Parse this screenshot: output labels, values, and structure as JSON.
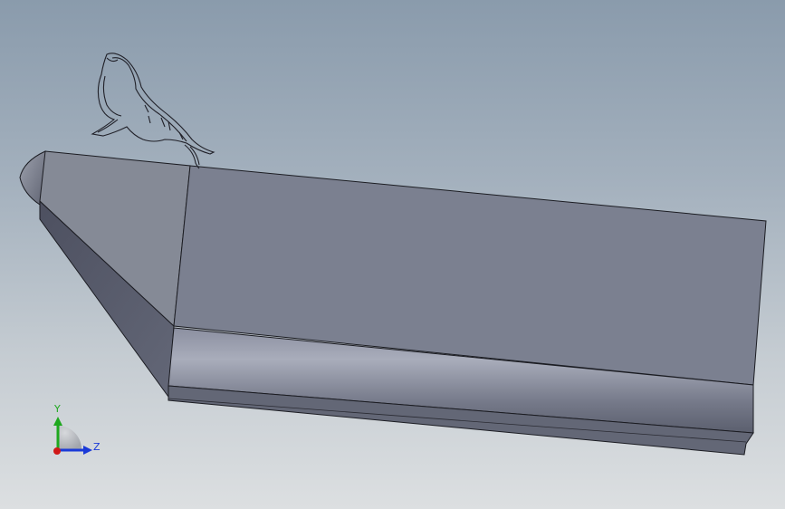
{
  "viewport": {
    "model": "boat-hull-model",
    "colors": {
      "face_top": "#7b8090",
      "face_bow": "#848995",
      "face_bow_side": "#55596a",
      "rail_light": "#a7abb9",
      "rail_dark": "#5d6170",
      "edge": "#1b1c22",
      "sketch": "#202028"
    }
  },
  "triad": {
    "y_label": "Y",
    "z_label": "Z",
    "y_color": "#1ea81e",
    "z_color": "#1a3ad8",
    "x_color": "#d01818"
  }
}
